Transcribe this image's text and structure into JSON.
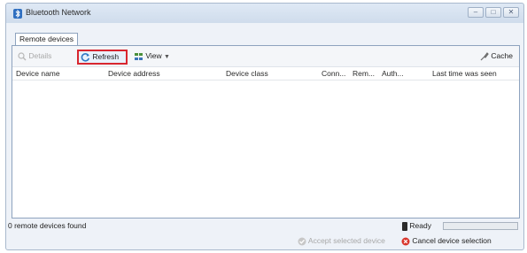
{
  "window": {
    "title": "Bluetooth Network",
    "controls": {
      "minimize": "–",
      "maximize": "□",
      "close": "✕"
    }
  },
  "tabs": [
    {
      "label": "Remote devices",
      "selected": true
    }
  ],
  "toolbar": {
    "details_label": "Details",
    "refresh_label": "Refresh",
    "view_label": "View",
    "cache_label": "Cache",
    "icons": {
      "details": "magnifier-icon",
      "refresh": "refresh-icon",
      "view": "view-icon",
      "cache": "cache-icon"
    }
  },
  "table": {
    "columns": [
      "Device name",
      "Device address",
      "Device class",
      "Conn...",
      "Rem...",
      "Auth...",
      "Last time was seen"
    ],
    "rows": []
  },
  "status": {
    "devices_found": "0 remote devices found",
    "ready_label": "Ready",
    "progress": 0
  },
  "actions": {
    "accept_label": "Accept selected device",
    "cancel_label": "Cancel device selection"
  },
  "colors": {
    "highlight_border": "#d8262f",
    "accent_blue": "#2f78c4",
    "cancel_red": "#d9362c"
  }
}
